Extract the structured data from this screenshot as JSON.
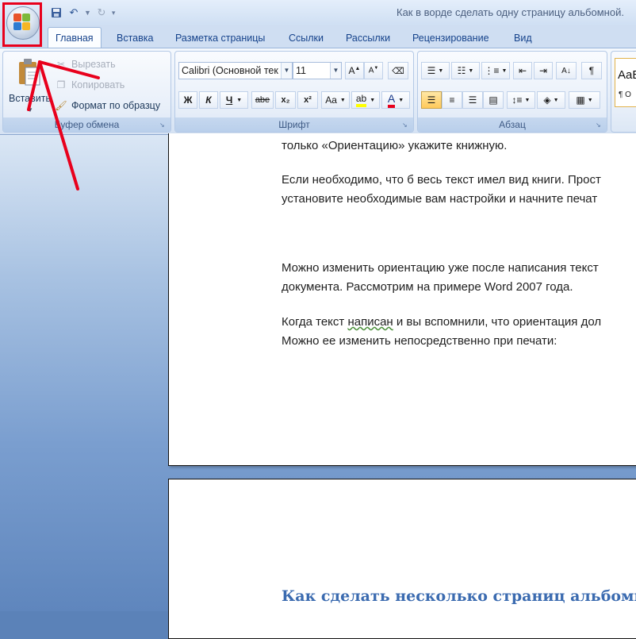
{
  "window": {
    "title": "Как в ворде сделать одну страницу альбомной."
  },
  "tabs": [
    "Главная",
    "Вставка",
    "Разметка страницы",
    "Ссылки",
    "Рассылки",
    "Рецензирование",
    "Вид"
  ],
  "clipboard": {
    "paste": "Вставить",
    "cut": "Вырезать",
    "copy": "Копировать",
    "format_painter": "Формат по образцу",
    "label": "Буфер обмена"
  },
  "font": {
    "name": "Calibri (Основной тек",
    "size": "11",
    "bold": "Ж",
    "italic": "К",
    "underline": "Ч",
    "strikethrough": "abe",
    "subscript": "x₂",
    "superscript": "x²",
    "case": "Aa",
    "label": "Шрифт"
  },
  "paragraph": {
    "label": "Абзац",
    "pilcrow": "¶"
  },
  "styles": {
    "preview": "AaB",
    "normal": "¶ О"
  },
  "document": {
    "page1_lines": [
      "только «Ориентацию» укажите книжную.",
      "Если необходимо, что б весь текст имел вид книги. Прост",
      "установите необходимые вам настройки и начните печат",
      "Можно изменить ориентацию уже после написания текст",
      "документа. Рассмотрим на примере  Word 2007 года.",
      "Можно ее изменить непосредственно при печати:"
    ],
    "para4_before": "Когда текст ",
    "para4_underlined": "написан",
    "para4_after": " и вы вспомнили, что ориентация дол",
    "heading": "Как сделать несколько страниц альбомны"
  },
  "colors": {
    "highlight": "#ffff00",
    "font_color": "#e8001c",
    "annotation": "#e8001c",
    "heading": "#3b6bb0"
  }
}
